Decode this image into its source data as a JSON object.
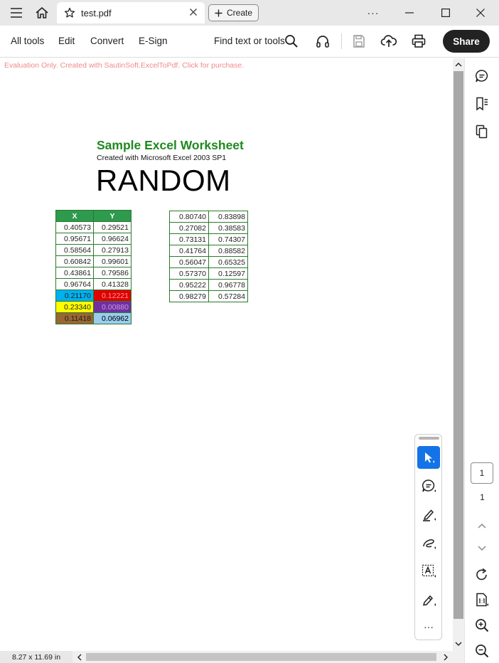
{
  "titlebar": {
    "tab_title": "test.pdf",
    "create_label": "Create",
    "more_label": "···"
  },
  "toolbar": {
    "menu": [
      "All tools",
      "Edit",
      "Convert",
      "E-Sign"
    ],
    "find_label": "Find text or tools",
    "share_label": "Share"
  },
  "document": {
    "eval_notice": "Evaluation Only. Created with SautinSoft.ExcelToPdf. Click for purchase.",
    "title": "Sample Excel Worksheet",
    "subtitle": "Created with Microsoft Excel 2003 SP1",
    "heading": "RANDOM",
    "xy_table": {
      "headers": [
        "X",
        "Y"
      ],
      "rows": [
        [
          "0.40573",
          "0.29521"
        ],
        [
          "0.95671",
          "0.96624"
        ],
        [
          "0.58564",
          "0.27913"
        ],
        [
          "0.60842",
          "0.99601"
        ],
        [
          "0.43861",
          "0.79586"
        ],
        [
          "0.96764",
          "0.41328"
        ],
        [
          "0.21170",
          "0.12221"
        ],
        [
          "0.23340",
          "0.00880"
        ],
        [
          "0.11418",
          "0.06962"
        ]
      ],
      "highlight_colors": [
        {
          "row": 6,
          "x_bg": "#00b0f0",
          "y_bg": "#e00000",
          "y_fg": "#ff9999"
        },
        {
          "row": 7,
          "x_bg": "#ffff00",
          "y_bg": "#7030a0",
          "y_fg": "#c89ae0"
        },
        {
          "row": 8,
          "x_bg": "#996633",
          "y_bg": "#99ccee",
          "y_fg": "#000000"
        }
      ]
    },
    "right_table": {
      "rows": [
        [
          "0.80740",
          "0.83898"
        ],
        [
          "0.27082",
          "0.38583"
        ],
        [
          "0.73131",
          "0.74307"
        ],
        [
          "0.41764",
          "0.88582"
        ],
        [
          "0.56047",
          "0.65325"
        ],
        [
          "0.57370",
          "0.12597"
        ],
        [
          "0.95222",
          "0.96778"
        ],
        [
          "0.98279",
          "0.57284"
        ]
      ]
    }
  },
  "navigation": {
    "current_page": "1",
    "total_pages": "1"
  },
  "status": {
    "page_size": "8.27 x 11.69 in"
  },
  "colors": {
    "accent": "#1473e6",
    "share_bg": "#222222",
    "title_green": "#1f8a1f",
    "header_green": "#2e9a4e"
  }
}
